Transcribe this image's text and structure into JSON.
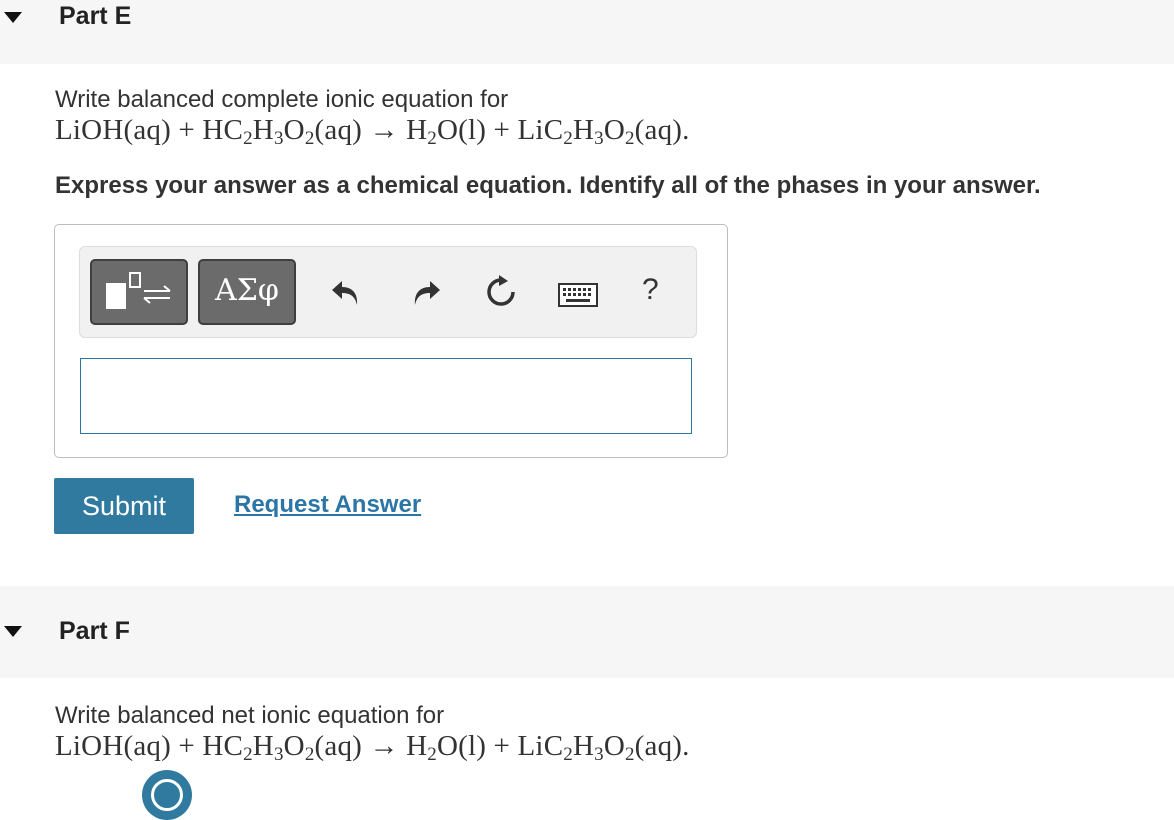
{
  "partE": {
    "title": "Part E",
    "prompt": "Write balanced complete ionic equation for",
    "instruction": "Express your answer as a chemical equation. Identify all of the phases in your answer.",
    "toolbar": {
      "templates_icon": "templates-icon",
      "greek_label": "ΑΣφ",
      "undo_icon": "undo-icon",
      "redo_icon": "redo-icon",
      "reset_icon": "reset-icon",
      "keyboard_icon": "keyboard-icon",
      "help_label": "?"
    },
    "answer_value": "",
    "submit_label": "Submit",
    "request_label": "Request Answer"
  },
  "partF": {
    "title": "Part F",
    "prompt": "Write balanced net ionic equation for"
  },
  "equation": {
    "reactant1": "LiOH(aq)",
    "plus": "+",
    "reactant2_prefix": "HC",
    "arrow": "→",
    "product1_prefix": "H",
    "product2_prefix": "LiC"
  },
  "colors": {
    "accent": "#2f7a9e",
    "link": "#2b76a6",
    "header_bg": "#f6f6f6"
  }
}
